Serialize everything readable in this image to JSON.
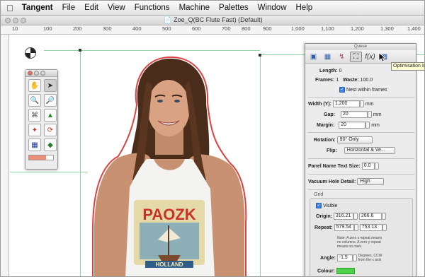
{
  "menubar": {
    "app": "Tangent",
    "items": [
      "File",
      "Edit",
      "View",
      "Functions",
      "Machine",
      "Palettes",
      "Window",
      "Help"
    ]
  },
  "window": {
    "title": "Zoe_Q(BC Flute Fast) (Default)"
  },
  "ruler": {
    "labels": [
      "10",
      "100",
      "200",
      "300",
      "400",
      "500",
      "600",
      "700",
      "800",
      "900",
      "1,000",
      "1,100",
      "1,200",
      "1,300",
      "1,400"
    ]
  },
  "inspector": {
    "title": "Queue",
    "tooltip": "Optimisation Inspector",
    "length_label": "Length:",
    "length_value": "0",
    "frames_label": "Frames:",
    "frames_value": "1",
    "waste_label": "Waste:",
    "waste_value": "100.0",
    "nest_label": "Nest within frames",
    "width_label": "Width (Y):",
    "width_value": "1,200",
    "width_unit": "mm",
    "gap_label": "Gap:",
    "gap_value": "20",
    "gap_unit": "mm",
    "margin_label": "Margin:",
    "margin_value": "20",
    "margin_unit": "mm",
    "rotation_label": "Rotation:",
    "rotation_value": "90° Only",
    "flip_label": "Flip:",
    "flip_value": "Horizontal & Ve...",
    "panel_text_label": "Panel Name Text Size:",
    "panel_text_value": "0.0",
    "vacuum_label": "Vacuum Hole Detail:",
    "vacuum_value": "High",
    "grid_label": "Grid",
    "visible_label": "Visible",
    "origin_label": "Origin:",
    "origin_x": "316.21",
    "origin_y": "266.6",
    "repeat_label": "Repeat:",
    "repeat_x": "579.54",
    "repeat_y": "753.13",
    "repeat_note": "Note: A zero x repeat means no columns. A zero y repeat means no rows.",
    "angle_label": "Angle:",
    "angle_value": "-1.5",
    "angle_note": "Degrees, CCW from the x axis",
    "colour_label": "Colour:"
  },
  "shirt_text": "PAOZK",
  "shirt_subtext": "HOLLAND",
  "colors": {
    "accent": "#3b82e8",
    "guide": "#8fd6a8",
    "outline": "#e04040"
  }
}
